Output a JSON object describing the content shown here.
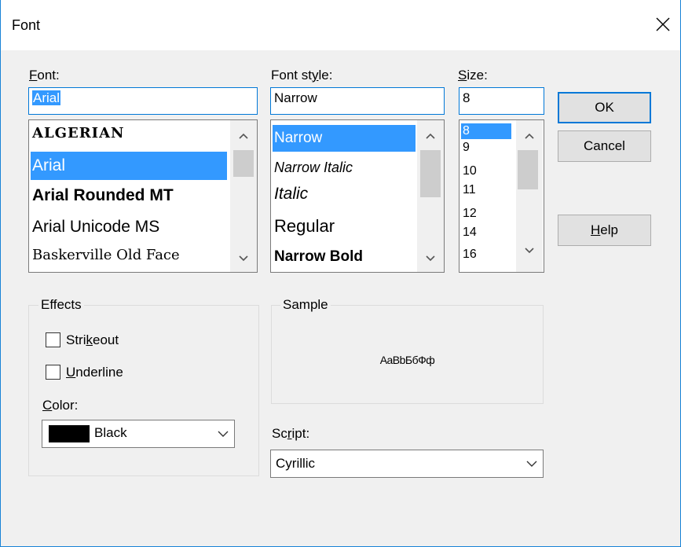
{
  "window": {
    "title": "Font",
    "close_icon": "close-icon"
  },
  "font": {
    "label": "Font:",
    "value": "Arial",
    "items": [
      {
        "label": "ALGERIAN",
        "selected": false
      },
      {
        "label": "Arial",
        "selected": true
      },
      {
        "label": "Arial Rounded MT",
        "selected": false
      },
      {
        "label": "Arial Unicode MS",
        "selected": false
      },
      {
        "label": "Baskerville Old Face",
        "selected": false
      }
    ]
  },
  "font_style": {
    "label": "Font style:",
    "value": "Narrow",
    "items": [
      {
        "label": "Narrow",
        "selected": true
      },
      {
        "label": "Narrow Italic",
        "selected": false
      },
      {
        "label": "Italic",
        "selected": false
      },
      {
        "label": "Regular",
        "selected": false
      },
      {
        "label": "Narrow Bold",
        "selected": false
      }
    ]
  },
  "size": {
    "label": "Size:",
    "value": "8",
    "items": [
      {
        "label": "8",
        "selected": true
      },
      {
        "label": "9",
        "selected": false
      },
      {
        "label": "10",
        "selected": false
      },
      {
        "label": "11",
        "selected": false
      },
      {
        "label": "12",
        "selected": false
      },
      {
        "label": "14",
        "selected": false
      },
      {
        "label": "16",
        "selected": false
      }
    ]
  },
  "buttons": {
    "ok": "OK",
    "cancel": "Cancel",
    "help": "Help"
  },
  "effects": {
    "title": "Effects",
    "strikeout": {
      "label": "Strikeout",
      "checked": false
    },
    "underline": {
      "label": "Underline",
      "checked": false
    },
    "color_label": "Color:",
    "color_value": "Black",
    "color_swatch": "#000000"
  },
  "sample": {
    "title": "Sample",
    "text": "AaBbБбФф"
  },
  "script": {
    "label": "Script:",
    "value": "Cyrillic"
  },
  "colors": {
    "accent": "#0078d7",
    "selection": "#3399ff"
  }
}
